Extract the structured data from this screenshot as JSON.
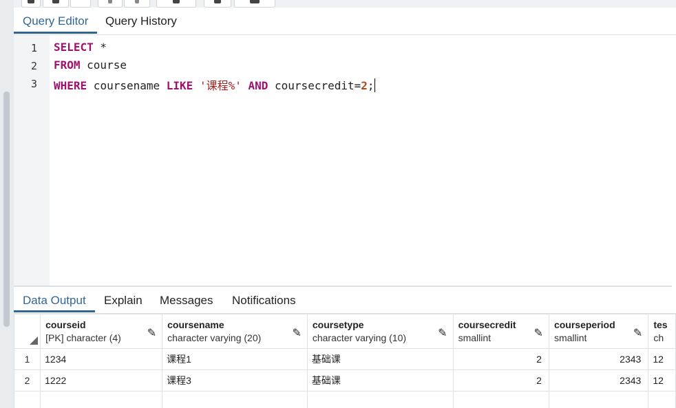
{
  "tabs": {
    "query_editor": "Query Editor",
    "query_history": "Query History"
  },
  "editor": {
    "line_numbers": [
      "1",
      "2",
      "3"
    ],
    "line1": {
      "kw": "SELECT",
      "rest": " *"
    },
    "line2": {
      "kw": "FROM",
      "rest": " course"
    },
    "line3": {
      "kw1": "WHERE",
      "t1": " coursename ",
      "kw2": "LIKE",
      "t2": " ",
      "str": "'课程%'",
      "t3": " ",
      "kw3": "AND",
      "t4": " coursecredit=",
      "num": "2",
      "t5": ";"
    }
  },
  "output_tabs": {
    "data_output": "Data Output",
    "explain": "Explain",
    "messages": "Messages",
    "notifications": "Notifications"
  },
  "grid": {
    "columns": [
      {
        "name": "courseid",
        "type": "[PK] character (4)"
      },
      {
        "name": "coursename",
        "type": "character varying (20)"
      },
      {
        "name": "coursetype",
        "type": "character varying (10)"
      },
      {
        "name": "coursecredit",
        "type": "smallint"
      },
      {
        "name": "courseperiod",
        "type": "smallint"
      },
      {
        "name": "tes",
        "type": "ch"
      }
    ],
    "rows": [
      {
        "num": "1",
        "cells": [
          "1234",
          "课程1",
          "基础课",
          "2",
          "2343",
          "12"
        ]
      },
      {
        "num": "2",
        "cells": [
          "1222",
          "课程3",
          "基础课",
          "2",
          "2343",
          "12"
        ]
      }
    ]
  },
  "icons": {
    "edit": "pencil-icon",
    "sort": "sort-corner-icon"
  },
  "colors": {
    "accent": "#326690",
    "keyword": "#a0106e",
    "string": "#a11f1f",
    "number": "#b3471a"
  }
}
